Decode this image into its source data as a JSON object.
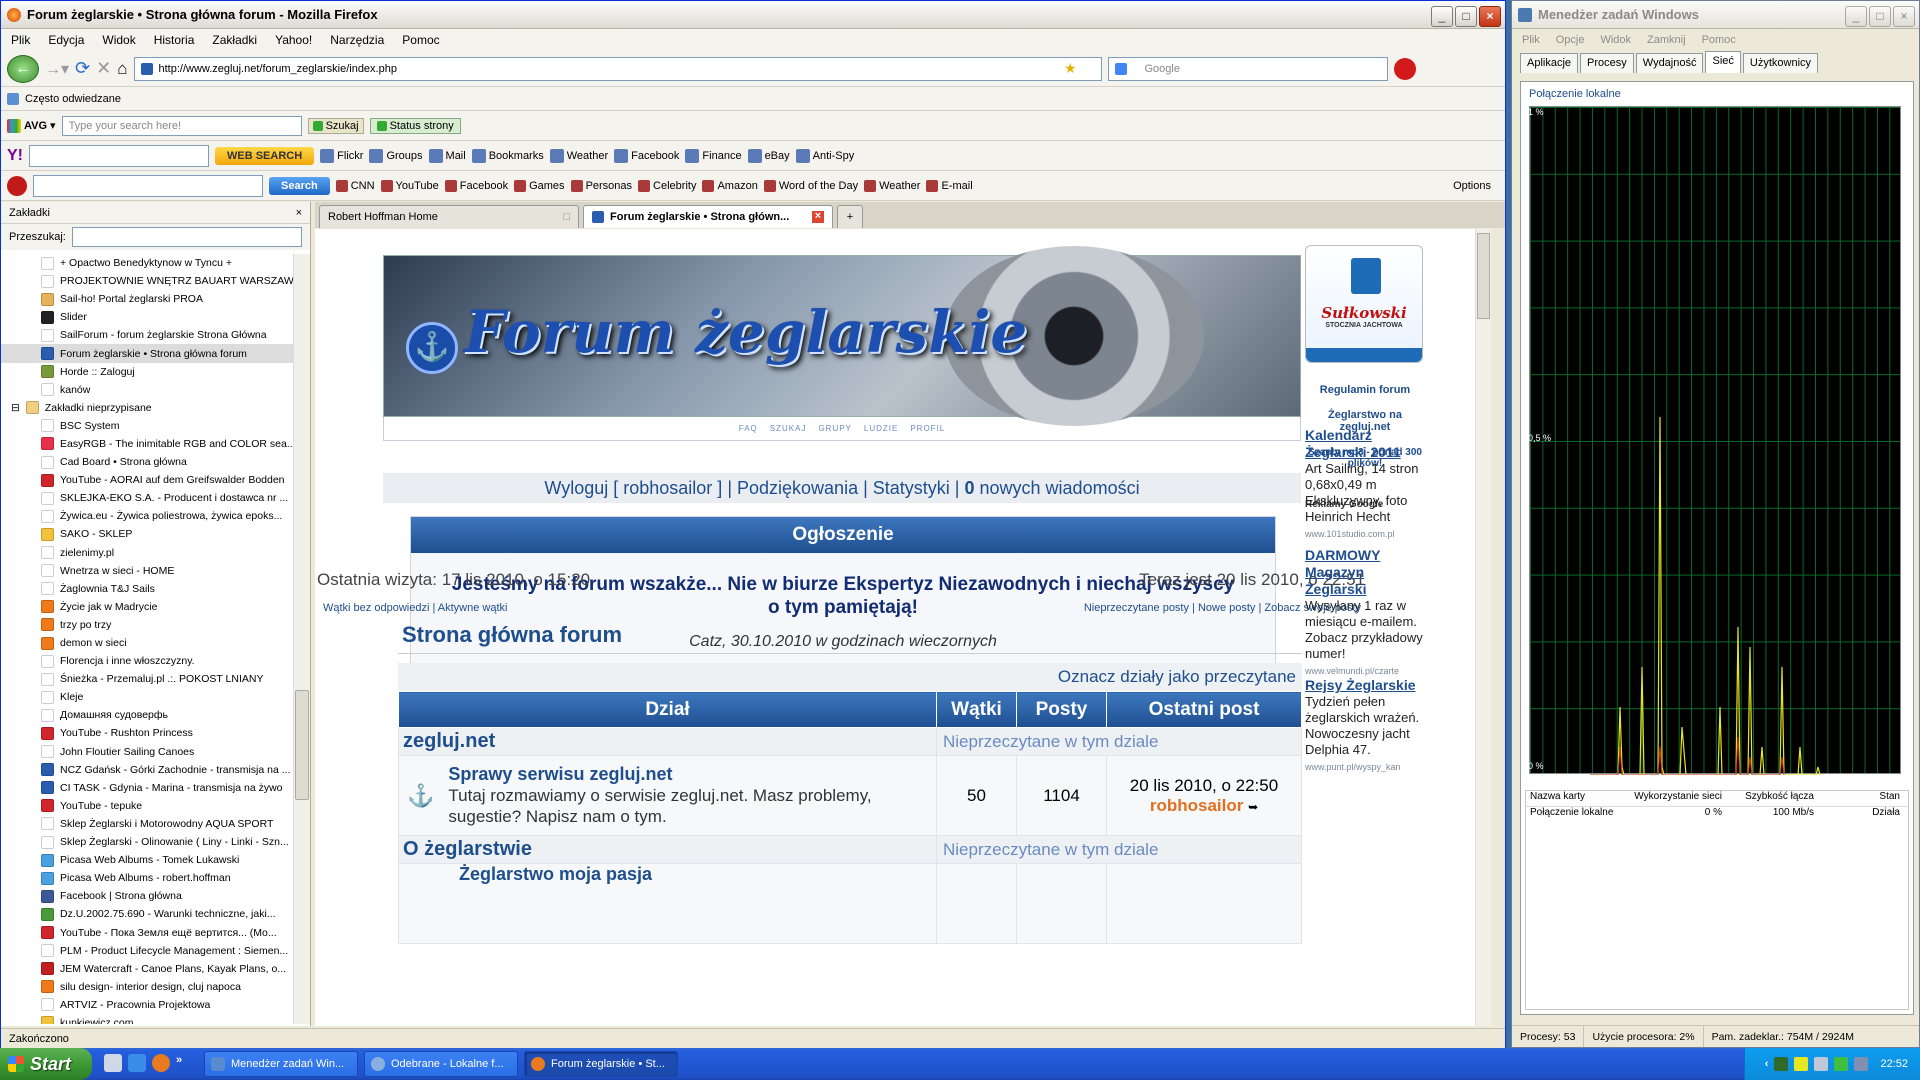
{
  "firefox": {
    "title": "Forum żeglarskie • Strona główna forum - Mozilla Firefox",
    "menu": [
      "Plik",
      "Edycja",
      "Widok",
      "Historia",
      "Zakładki",
      "Yahoo!",
      "Narzędzia",
      "Pomoc"
    ],
    "url": "http://www.zegluj.net/forum_zeglarskie/index.php",
    "search_placeholder": "Google",
    "bookmarks_toolbar": "Często odwiedzane",
    "avg": {
      "label": "AVG",
      "placeholder": "Type your search here!",
      "search": "Szukaj",
      "status": "Status strony"
    },
    "yahoo": {
      "web_search": "WEB SEARCH",
      "items": [
        "Flickr",
        "Groups",
        "Mail",
        "Bookmarks",
        "Weather",
        "Facebook",
        "Finance",
        "eBay",
        "Anti-Spy"
      ]
    },
    "ask": {
      "search": "Search",
      "items": [
        "CNN",
        "YouTube",
        "Facebook",
        "Games",
        "Personas",
        "Celebrity",
        "Amazon",
        "Word of the Day",
        "Weather",
        "E-mail"
      ],
      "options": "Options"
    },
    "status": "Zakończono"
  },
  "sidebar": {
    "title": "Zakładki",
    "search_label": "Przeszukaj:",
    "items": [
      {
        "label": "+ Opactwo Benedyktynow w Tyncu +",
        "color": "#ffffff"
      },
      {
        "label": "PROJEKTOWNIE WNĘTRZ BAUART WARSZAWA",
        "color": "#ffffff"
      },
      {
        "label": "Sail-ho! Portal żeglarski PROA",
        "color": "#e8b25a"
      },
      {
        "label": "Slider",
        "color": "#222222"
      },
      {
        "label": "SailForum - forum żeglarskie Strona Główna",
        "color": "#ffffff"
      },
      {
        "label": "Forum żeglarskie • Strona główna forum",
        "color": "#2a5db0",
        "selected": true
      },
      {
        "label": "Horde :: Zaloguj",
        "color": "#7a9a3a"
      },
      {
        "label": "kanów",
        "color": "#ffffff"
      },
      {
        "label": "Zakładki nieprzypisane",
        "color": "#f0d080",
        "folder": true
      },
      {
        "label": "BSC System",
        "color": "#ffffff"
      },
      {
        "label": "EasyRGB - The inimitable RGB and COLOR sea...",
        "color": "#e8304a"
      },
      {
        "label": "Cad Board • Strona główna",
        "color": "#ffffff"
      },
      {
        "label": "YouTube - AORAI auf dem Greifswalder Bodden",
        "color": "#d0252a"
      },
      {
        "label": "SKLEJKA-EKO S.A. - Producent i dostawca nr ...",
        "color": "#ffffff"
      },
      {
        "label": "Żywica.eu - Żywica poliestrowa, żywica epoks...",
        "color": "#ffffff"
      },
      {
        "label": "SAKO - SKLEP",
        "color": "#f2c23a"
      },
      {
        "label": "zielenimy.pl",
        "color": "#ffffff"
      },
      {
        "label": "Wnetrza w sieci - HOME",
        "color": "#ffffff"
      },
      {
        "label": "Żaglownia T&J Sails",
        "color": "#ffffff"
      },
      {
        "label": "Życie jak w Madrycie",
        "color": "#f07a1a"
      },
      {
        "label": "trzy po trzy",
        "color": "#f07a1a"
      },
      {
        "label": "demon w sieci",
        "color": "#f07a1a"
      },
      {
        "label": "Florencja i inne włoszczyzny.",
        "color": "#ffffff"
      },
      {
        "label": "Śnieżka - Przemaluj.pl .:. POKOST LNIANY",
        "color": "#ffffff"
      },
      {
        "label": "Kleje",
        "color": "#ffffff"
      },
      {
        "label": "Домашняя судоверфь",
        "color": "#ffffff"
      },
      {
        "label": "YouTube - Rushton Princess",
        "color": "#d0252a"
      },
      {
        "label": "John Floutier Sailing Canoes",
        "color": "#ffffff"
      },
      {
        "label": "NCZ Gdańsk - Górki Zachodnie - transmisja na ...",
        "color": "#2a5db0"
      },
      {
        "label": "CI TASK - Gdynia - Marina - transmisja na żywo",
        "color": "#2a5db0"
      },
      {
        "label": "YouTube - tepuke",
        "color": "#d0252a"
      },
      {
        "label": "Sklep Żeglarski i Motorowodny AQUA SPORT",
        "color": "#ffffff"
      },
      {
        "label": "Sklep Żeglarski - Olinowanie ( Liny - Linki - Szn...",
        "color": "#ffffff"
      },
      {
        "label": "Picasa Web Albums - Tomek Lukawski",
        "color": "#4aa0e0"
      },
      {
        "label": "Picasa Web Albums - robert.hoffman",
        "color": "#4aa0e0"
      },
      {
        "label": "Facebook | Strona główna",
        "color": "#3b5998"
      },
      {
        "label": "Dz.U.2002.75.690 - Warunki techniczne, jaki...",
        "color": "#4a9a3a"
      },
      {
        "label": "YouTube - Пока Земля ещё вертится... (Mo...",
        "color": "#d0252a"
      },
      {
        "label": "PLM - Product Lifecycle Management : Siemen...",
        "color": "#ffffff"
      },
      {
        "label": "JEM Watercraft - Canoe Plans, Kayak Plans, o...",
        "color": "#c02020"
      },
      {
        "label": "silu design- interior design, cluj napoca",
        "color": "#f07a1a"
      },
      {
        "label": "ARTVIZ - Pracownia Projektowa",
        "color": "#ffffff"
      },
      {
        "label": "kunkiewicz.com",
        "color": "#f2c23a"
      }
    ]
  },
  "tabs": [
    {
      "label": "Robert Hoffman Home",
      "active": false
    },
    {
      "label": "Forum żeglarskie • Strona główn...",
      "active": true
    }
  ],
  "page": {
    "banner_title": "Forum żeglarskie",
    "navlinks": [
      "FAQ",
      "SZUKAJ",
      "GRUPY",
      "LUDZIE",
      "PROFIL"
    ],
    "userbar": {
      "logout": "Wyloguj [ robhosailor ]",
      "thanks": "Podziękowania",
      "stats": "Statystyki",
      "messages_count": "0",
      "messages_label": "nowych wiadomości"
    },
    "announcement": {
      "title": "Ogłoszenie",
      "message": "Jesteśmy na forum wszakże... Nie w biurze Ekspertyz Niezawodnych i niechaj wszyscy o tym pamiętają!",
      "signature": "Catz, 30.10.2010 w godzinach wieczornych"
    },
    "last_visit": "Ostatnia wizyta: 17 lis 2010, o 15:20",
    "now": "Teraz jest 20 lis 2010, o 22:51",
    "links_left": "Wątki bez odpowiedzi | Aktywne wątki",
    "links_right": "Nieprzeczytane posty | Nowe posty | Zobacz swoje posty",
    "forum_title": "Strona główna forum",
    "mark_read": "Oznacz działy jako przeczytane",
    "table_headers": [
      "Dział",
      "Wątki",
      "Posty",
      "Ostatni post"
    ],
    "categories": [
      {
        "name": "zegluj.net",
        "unread": "Nieprzeczytane w tym dziale"
      },
      {
        "name": "O żeglarstwie",
        "unread": "Nieprzeczytane w tym dziale"
      }
    ],
    "forums": [
      {
        "name": "Sprawy serwisu zegluj.net",
        "desc": "Tutaj rozmawiamy o serwisie zegluj.net. Masz problemy, sugestie? Napisz nam o tym.",
        "topics": "50",
        "posts": "1104",
        "last_date": "20 lis 2010, o 22:50",
        "last_user": "robhosailor"
      },
      {
        "name": "Żeglarstwo moja pasja"
      }
    ],
    "right": {
      "sponsor_name": "Sułkowski",
      "sponsor_sub": "STOCZNIA JACHTOWA",
      "regulamin": "Regulamin forum",
      "zeglarstwo": "Żeglarstwo na zegluj.net",
      "szanty": "Szanty mp3 - ponad 300 plików!",
      "ads_label": "Reklamy Google",
      "ads": [
        {
          "title": "Kalendarz Żeglarski 2011",
          "text": "Art Sailing, 14 stron 0,68x0,49 m Ekskluzywny, foto Heinrich Hecht",
          "url": "www.101studio.com.pl"
        },
        {
          "title": "DARMOWY Magazyn Żeglarski",
          "text": "Wysyłany 1 raz w miesiącu e-mailem. Zobacz przykładowy numer!",
          "url": "www.velmundi.pl/czarte"
        },
        {
          "title": "Rejsy Żeglarskie",
          "text": "Tydzień pełen żeglarskich wrażeń. Nowoczesny jacht Delphia 47.",
          "url": "www.punt.pl/wyspy_kan"
        }
      ]
    }
  },
  "taskmgr": {
    "title": "Menedżer zadań Windows",
    "menu": [
      "Plik",
      "Opcje",
      "Widok",
      "Zamknij",
      "Pomoc"
    ],
    "tabs": [
      "Aplikacje",
      "Procesy",
      "Wydajność",
      "Sieć",
      "Użytkownicy"
    ],
    "graph_label": "Połączenie lokalne",
    "ticks": [
      "1 %",
      "0,5 %",
      "0 %"
    ],
    "table_headers": [
      "Nazwa karty",
      "Wykorzystanie sieci",
      "Szybkość łącza",
      "Stan"
    ],
    "rows": [
      [
        "Połączenie lokalne",
        "0 %",
        "100 Mb/s",
        "Działa"
      ]
    ],
    "status": [
      "Procesy: 53",
      "Użycie procesora: 2%",
      "Pam. zadeklar.: 754M / 2924M"
    ]
  },
  "taskbar": {
    "start": "Start",
    "buttons": [
      "Menedżer zadań Win...",
      "Odebrane - Lokalne f...",
      "Forum żeglarskie • St..."
    ],
    "clock": "22:52"
  }
}
